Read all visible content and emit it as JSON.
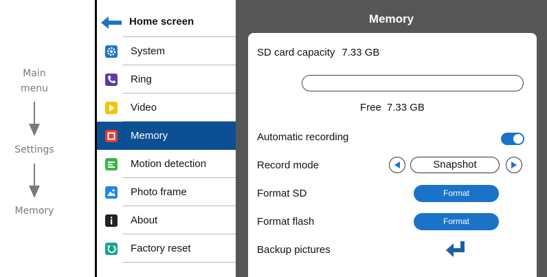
{
  "breadcrumb": {
    "main_menu": "Main\nmenu",
    "settings": "Settings",
    "memory": "Memory"
  },
  "menu": {
    "home_label": "Home screen",
    "items": [
      {
        "label": "System",
        "icon": "gear-icon",
        "color": "#1a73c8"
      },
      {
        "label": "Ring",
        "icon": "phone-icon",
        "color": "#5b3aa8"
      },
      {
        "label": "Video",
        "icon": "play-icon",
        "color": "#f5c400"
      },
      {
        "label": "Memory",
        "icon": "memory-icon",
        "color": "#e53935",
        "active": true
      },
      {
        "label": "Motion detection",
        "icon": "motion-icon",
        "color": "#3bb54a"
      },
      {
        "label": "Photo frame",
        "icon": "photo-icon",
        "color": "#1e88e5"
      },
      {
        "label": "About",
        "icon": "info-icon",
        "color": "#222222"
      },
      {
        "label": "Factory reset",
        "icon": "reset-icon",
        "color": "#1aa38f"
      }
    ]
  },
  "panel": {
    "title": "Memory",
    "capacity_label": "SD card capacity",
    "capacity_value": "7.33 GB",
    "used_fraction": 0.0,
    "free_label": "Free",
    "free_value": "7.33 GB",
    "auto_recording_label": "Automatic recording",
    "auto_recording_on": true,
    "record_mode_label": "Record mode",
    "record_mode_value": "Snapshot",
    "format_sd_label": "Format SD",
    "format_flash_label": "Format flash",
    "format_button_label": "Format",
    "backup_label": "Backup pictures"
  },
  "colors": {
    "accent": "#1a73c8",
    "active_row": "#0c4f93",
    "panel_bg": "#565656"
  }
}
